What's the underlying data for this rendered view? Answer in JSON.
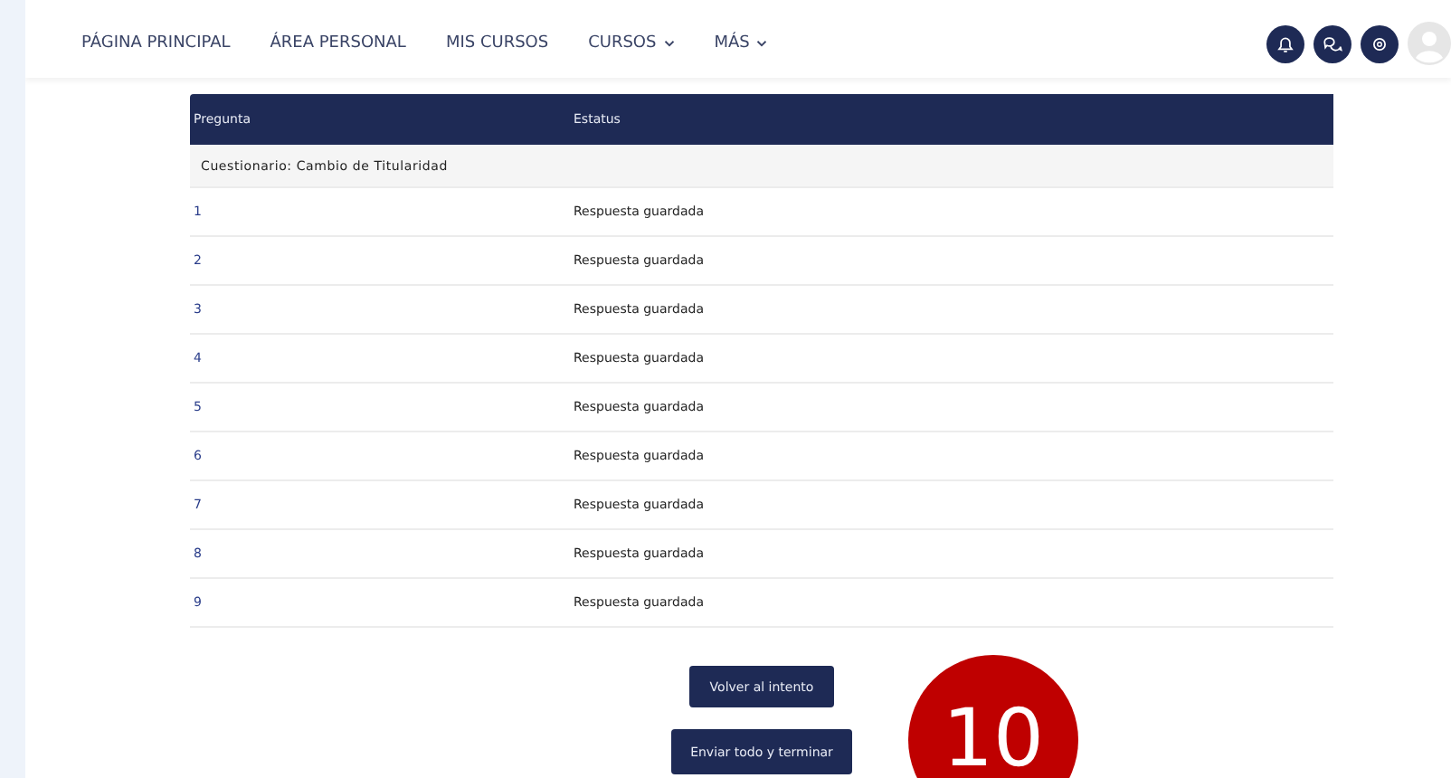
{
  "nav": {
    "items": [
      {
        "label": "PÁGINA PRINCIPAL",
        "dropdown": false
      },
      {
        "label": "ÁREA PERSONAL",
        "dropdown": false
      },
      {
        "label": "MIS CURSOS",
        "dropdown": false
      },
      {
        "label": "CURSOS",
        "dropdown": true
      },
      {
        "label": "MÁS",
        "dropdown": true
      }
    ]
  },
  "table": {
    "columns": [
      "Pregunta",
      "Estatus"
    ],
    "group": "Cuestionario: Cambio de Titularidad",
    "rows": [
      {
        "question": "1",
        "status": "Respuesta guardada"
      },
      {
        "question": "2",
        "status": "Respuesta guardada"
      },
      {
        "question": "3",
        "status": "Respuesta guardada"
      },
      {
        "question": "4",
        "status": "Respuesta guardada"
      },
      {
        "question": "5",
        "status": "Respuesta guardada"
      },
      {
        "question": "6",
        "status": "Respuesta guardada"
      },
      {
        "question": "7",
        "status": "Respuesta guardada"
      },
      {
        "question": "8",
        "status": "Respuesta guardada"
      },
      {
        "question": "9",
        "status": "Respuesta guardada"
      }
    ]
  },
  "buttons": [
    "Volver al intento",
    "Enviar todo y terminar"
  ],
  "badge": "10"
}
